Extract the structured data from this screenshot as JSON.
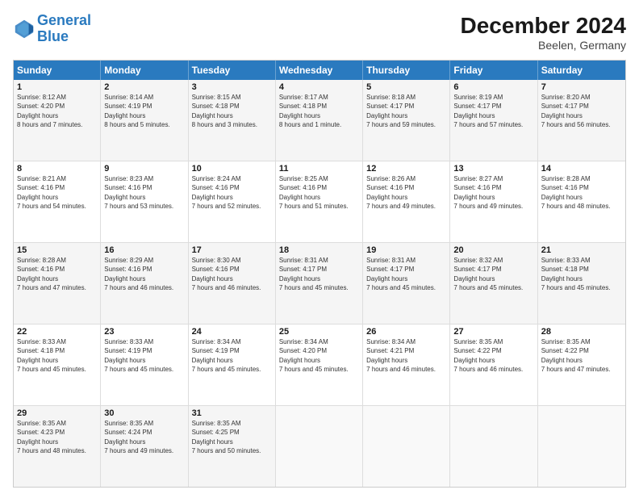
{
  "logo": {
    "line1": "General",
    "line2": "Blue"
  },
  "title": "December 2024",
  "subtitle": "Beelen, Germany",
  "header_days": [
    "Sunday",
    "Monday",
    "Tuesday",
    "Wednesday",
    "Thursday",
    "Friday",
    "Saturday"
  ],
  "weeks": [
    [
      {
        "day": "1",
        "sunrise": "8:12 AM",
        "sunset": "4:20 PM",
        "daylight": "8 hours and 7 minutes."
      },
      {
        "day": "2",
        "sunrise": "8:14 AM",
        "sunset": "4:19 PM",
        "daylight": "8 hours and 5 minutes."
      },
      {
        "day": "3",
        "sunrise": "8:15 AM",
        "sunset": "4:18 PM",
        "daylight": "8 hours and 3 minutes."
      },
      {
        "day": "4",
        "sunrise": "8:17 AM",
        "sunset": "4:18 PM",
        "daylight": "8 hours and 1 minute."
      },
      {
        "day": "5",
        "sunrise": "8:18 AM",
        "sunset": "4:17 PM",
        "daylight": "7 hours and 59 minutes."
      },
      {
        "day": "6",
        "sunrise": "8:19 AM",
        "sunset": "4:17 PM",
        "daylight": "7 hours and 57 minutes."
      },
      {
        "day": "7",
        "sunrise": "8:20 AM",
        "sunset": "4:17 PM",
        "daylight": "7 hours and 56 minutes."
      }
    ],
    [
      {
        "day": "8",
        "sunrise": "8:21 AM",
        "sunset": "4:16 PM",
        "daylight": "7 hours and 54 minutes."
      },
      {
        "day": "9",
        "sunrise": "8:23 AM",
        "sunset": "4:16 PM",
        "daylight": "7 hours and 53 minutes."
      },
      {
        "day": "10",
        "sunrise": "8:24 AM",
        "sunset": "4:16 PM",
        "daylight": "7 hours and 52 minutes."
      },
      {
        "day": "11",
        "sunrise": "8:25 AM",
        "sunset": "4:16 PM",
        "daylight": "7 hours and 51 minutes."
      },
      {
        "day": "12",
        "sunrise": "8:26 AM",
        "sunset": "4:16 PM",
        "daylight": "7 hours and 49 minutes."
      },
      {
        "day": "13",
        "sunrise": "8:27 AM",
        "sunset": "4:16 PM",
        "daylight": "7 hours and 49 minutes."
      },
      {
        "day": "14",
        "sunrise": "8:28 AM",
        "sunset": "4:16 PM",
        "daylight": "7 hours and 48 minutes."
      }
    ],
    [
      {
        "day": "15",
        "sunrise": "8:28 AM",
        "sunset": "4:16 PM",
        "daylight": "7 hours and 47 minutes."
      },
      {
        "day": "16",
        "sunrise": "8:29 AM",
        "sunset": "4:16 PM",
        "daylight": "7 hours and 46 minutes."
      },
      {
        "day": "17",
        "sunrise": "8:30 AM",
        "sunset": "4:16 PM",
        "daylight": "7 hours and 46 minutes."
      },
      {
        "day": "18",
        "sunrise": "8:31 AM",
        "sunset": "4:17 PM",
        "daylight": "7 hours and 45 minutes."
      },
      {
        "day": "19",
        "sunrise": "8:31 AM",
        "sunset": "4:17 PM",
        "daylight": "7 hours and 45 minutes."
      },
      {
        "day": "20",
        "sunrise": "8:32 AM",
        "sunset": "4:17 PM",
        "daylight": "7 hours and 45 minutes."
      },
      {
        "day": "21",
        "sunrise": "8:33 AM",
        "sunset": "4:18 PM",
        "daylight": "7 hours and 45 minutes."
      }
    ],
    [
      {
        "day": "22",
        "sunrise": "8:33 AM",
        "sunset": "4:18 PM",
        "daylight": "7 hours and 45 minutes."
      },
      {
        "day": "23",
        "sunrise": "8:33 AM",
        "sunset": "4:19 PM",
        "daylight": "7 hours and 45 minutes."
      },
      {
        "day": "24",
        "sunrise": "8:34 AM",
        "sunset": "4:19 PM",
        "daylight": "7 hours and 45 minutes."
      },
      {
        "day": "25",
        "sunrise": "8:34 AM",
        "sunset": "4:20 PM",
        "daylight": "7 hours and 45 minutes."
      },
      {
        "day": "26",
        "sunrise": "8:34 AM",
        "sunset": "4:21 PM",
        "daylight": "7 hours and 46 minutes."
      },
      {
        "day": "27",
        "sunrise": "8:35 AM",
        "sunset": "4:22 PM",
        "daylight": "7 hours and 46 minutes."
      },
      {
        "day": "28",
        "sunrise": "8:35 AM",
        "sunset": "4:22 PM",
        "daylight": "7 hours and 47 minutes."
      }
    ],
    [
      {
        "day": "29",
        "sunrise": "8:35 AM",
        "sunset": "4:23 PM",
        "daylight": "7 hours and 48 minutes."
      },
      {
        "day": "30",
        "sunrise": "8:35 AM",
        "sunset": "4:24 PM",
        "daylight": "7 hours and 49 minutes."
      },
      {
        "day": "31",
        "sunrise": "8:35 AM",
        "sunset": "4:25 PM",
        "daylight": "7 hours and 50 minutes."
      },
      {
        "day": "",
        "sunrise": "",
        "sunset": "",
        "daylight": ""
      },
      {
        "day": "",
        "sunrise": "",
        "sunset": "",
        "daylight": ""
      },
      {
        "day": "",
        "sunrise": "",
        "sunset": "",
        "daylight": ""
      },
      {
        "day": "",
        "sunrise": "",
        "sunset": "",
        "daylight": ""
      }
    ]
  ]
}
